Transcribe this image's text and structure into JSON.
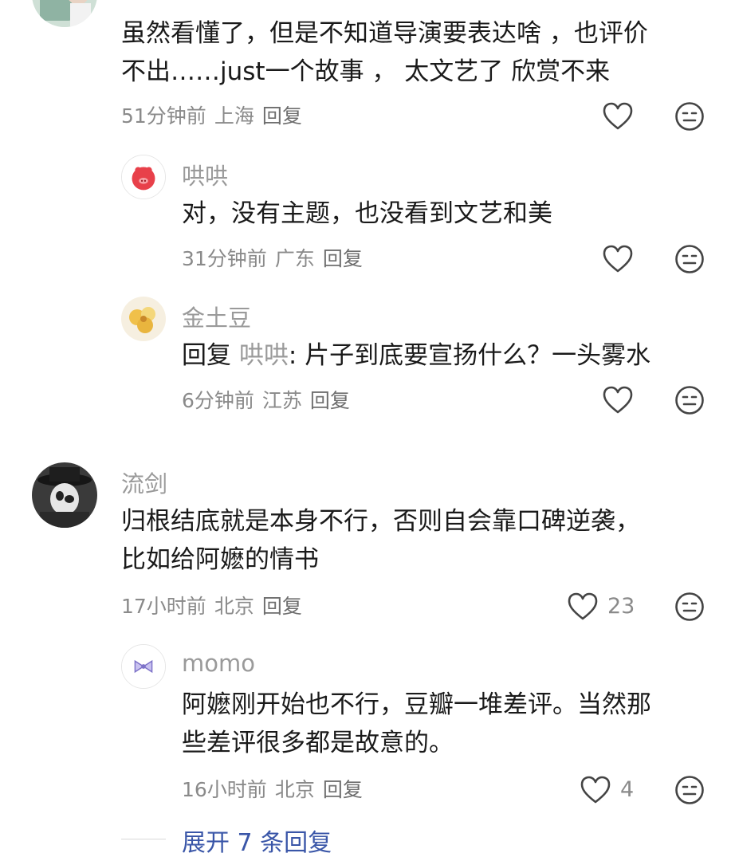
{
  "comments": [
    {
      "text_lines": [
        "虽然看懂了，但是不知道导演要表达啥 ，也评价",
        "不出……just一个故事 ， 太文艺了 欣赏不来"
      ],
      "time": "51分钟前",
      "location": "上海",
      "reply_label": "回复",
      "replies": [
        {
          "user": "哄哄",
          "text_lines": [
            "对，没有主题，也没看到文艺和美"
          ],
          "time": "31分钟前",
          "location": "广东",
          "reply_label": "回复"
        },
        {
          "user": "金土豆",
          "reply_prefix": "回复",
          "reply_to": "哄哄",
          "reply_text": ": 片子到底要宣扬什么？一头雾水",
          "time": "6分钟前",
          "location": "江苏",
          "reply_label": "回复"
        }
      ]
    },
    {
      "user": "流剑",
      "text_lines": [
        "归根结底就是本身不行，否则自会靠口碑逆袭，",
        "比如给阿嬷的情书"
      ],
      "time": "17小时前",
      "location": "北京",
      "reply_label": "回复",
      "likes": "23",
      "replies": [
        {
          "user": "momo",
          "text_lines": [
            "阿嬷刚开始也不行，豆瓣一堆差评。当然那",
            "些差评很多都是故意的。"
          ],
          "time": "16小时前",
          "location": "北京",
          "reply_label": "回复",
          "likes": "4"
        }
      ],
      "expand_label": "展开 7 条回复"
    }
  ],
  "icons": {
    "like": "heart-outline-icon",
    "dislike": "neutral-face-icon"
  },
  "colors": {
    "link": "#3a56a8",
    "meta": "#8a8a8a",
    "name": "#9a9a9a"
  }
}
